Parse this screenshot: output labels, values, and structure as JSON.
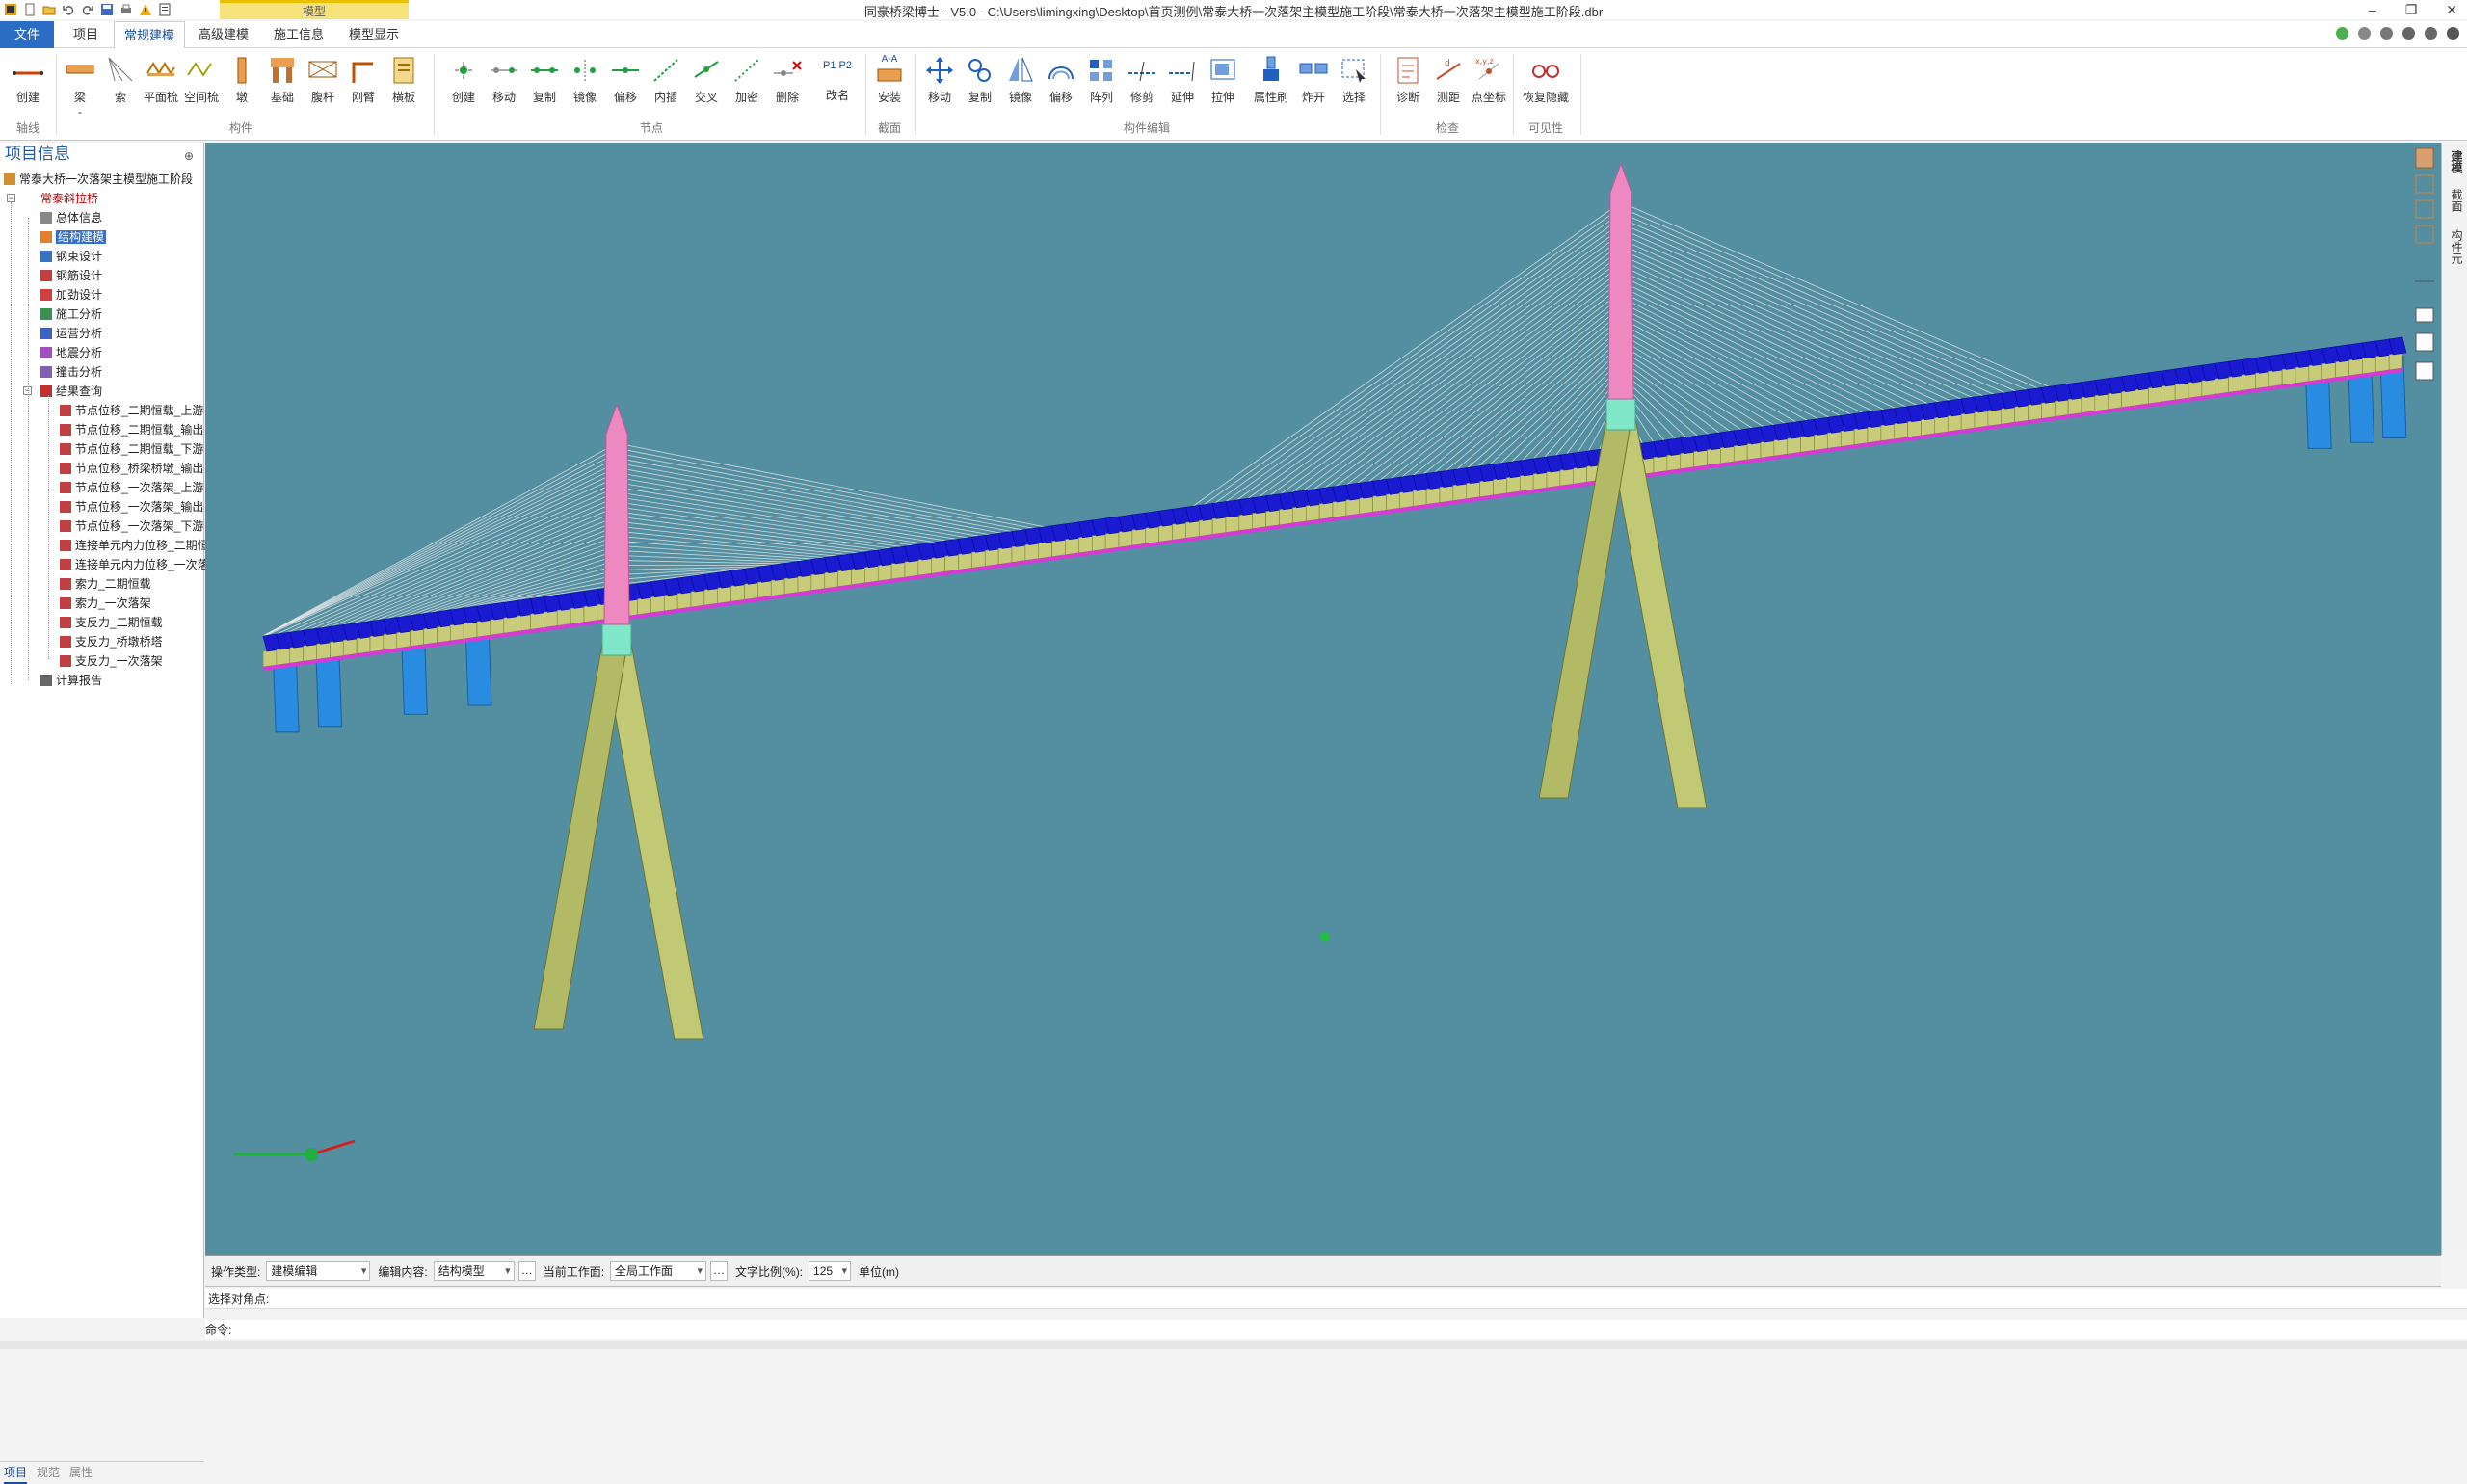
{
  "title": "同豪桥梁博士 - V5.0 - C:\\Users\\limingxing\\Desktop\\首页测例\\常泰大桥一次落架主模型施工阶段\\常泰大桥一次落架主模型施工阶段.dbr",
  "context_tab": "模型",
  "window_controls": [
    "–",
    "❐",
    "✕"
  ],
  "tabs": [
    "文件",
    "项目",
    "常规建模",
    "高级建模",
    "施工信息",
    "模型显示"
  ],
  "active_tab": "常规建模",
  "ribbon": {
    "groups": [
      {
        "name": "轴线",
        "buttons": [
          "创建"
        ]
      },
      {
        "name": "构件",
        "buttons": [
          "梁",
          "索",
          "平面梳",
          "空间梳",
          "墩",
          "基础",
          "腹杆",
          "刚臂",
          "横板"
        ]
      },
      {
        "name": "节点",
        "buttons": [
          "创建",
          "移动",
          "复制",
          "镜像",
          "偏移",
          "内插",
          "交叉",
          "加密",
          "删除",
          "改名"
        ]
      },
      {
        "name": "截面",
        "buttons": [
          "安装"
        ]
      },
      {
        "name": "构件编辑",
        "buttons": [
          "移动",
          "复制",
          "镜像",
          "偏移",
          "阵列",
          "修剪",
          "延伸",
          "拉伸",
          "属性刷",
          "炸开",
          "选择"
        ]
      },
      {
        "name": "检查",
        "buttons": [
          "诊断",
          "测距",
          "点坐标"
        ]
      },
      {
        "name": "可见性",
        "buttons": [
          "恢复隐藏"
        ]
      }
    ],
    "misc": {
      "beam_dropdown": "-",
      "rename_label": "P1 P2",
      "install_label": "A-A"
    }
  },
  "panel": {
    "title": "项目信息",
    "pin": "⊕",
    "root": "常泰大桥一次落架主模型施工阶段",
    "project": "常泰斜拉桥",
    "items": [
      "总体信息",
      "结构建模",
      "钢束设计",
      "钢筋设计",
      "加劲设计",
      "施工分析",
      "运营分析",
      "地震分析",
      "撞击分析",
      "结果查询"
    ],
    "results": [
      "节点位移_二期恒载_上游",
      "节点位移_二期恒载_输出",
      "节点位移_二期恒载_下游",
      "节点位移_桥梁桥墩_输出",
      "节点位移_一次落架_上游",
      "节点位移_一次落架_输出",
      "节点位移_一次落架_下游",
      "连接单元内力位移_二期恒",
      "连接单元内力位移_一次落",
      "索力_二期恒载",
      "索力_一次落架",
      "支反力_二期恒载",
      "支反力_桥墩桥塔",
      "支反力_一次落架"
    ],
    "report": "计算报告",
    "bottom_tabs": [
      "项目",
      "规范",
      "属性"
    ]
  },
  "right_tabs": [
    "建模",
    "截面",
    "构件元"
  ],
  "status": {
    "op_type_label": "操作类型:",
    "op_type_value": "建模编辑",
    "edit_label": "编辑内容:",
    "edit_value": "结构模型",
    "workplane_label": "当前工作面:",
    "workplane_value": "全局工作面",
    "ratio_label": "文字比例(%):",
    "ratio_value": "125",
    "unit": "单位(m)",
    "dots": "…"
  },
  "cmd_prompt": "选择对角点:",
  "cmd_label": "命令:",
  "colors": {
    "viewport_bg": "#548fa1",
    "deck_top": "#1a1ad0",
    "deck_truss": "#c8cc7a",
    "deck_bottom": "#d838d8",
    "tower": "#c2c974",
    "tower_top": "#ee88c0",
    "tower_joint": "#80e8c8",
    "pier": "#2a8ce0",
    "cable": "#e8e8e8"
  }
}
